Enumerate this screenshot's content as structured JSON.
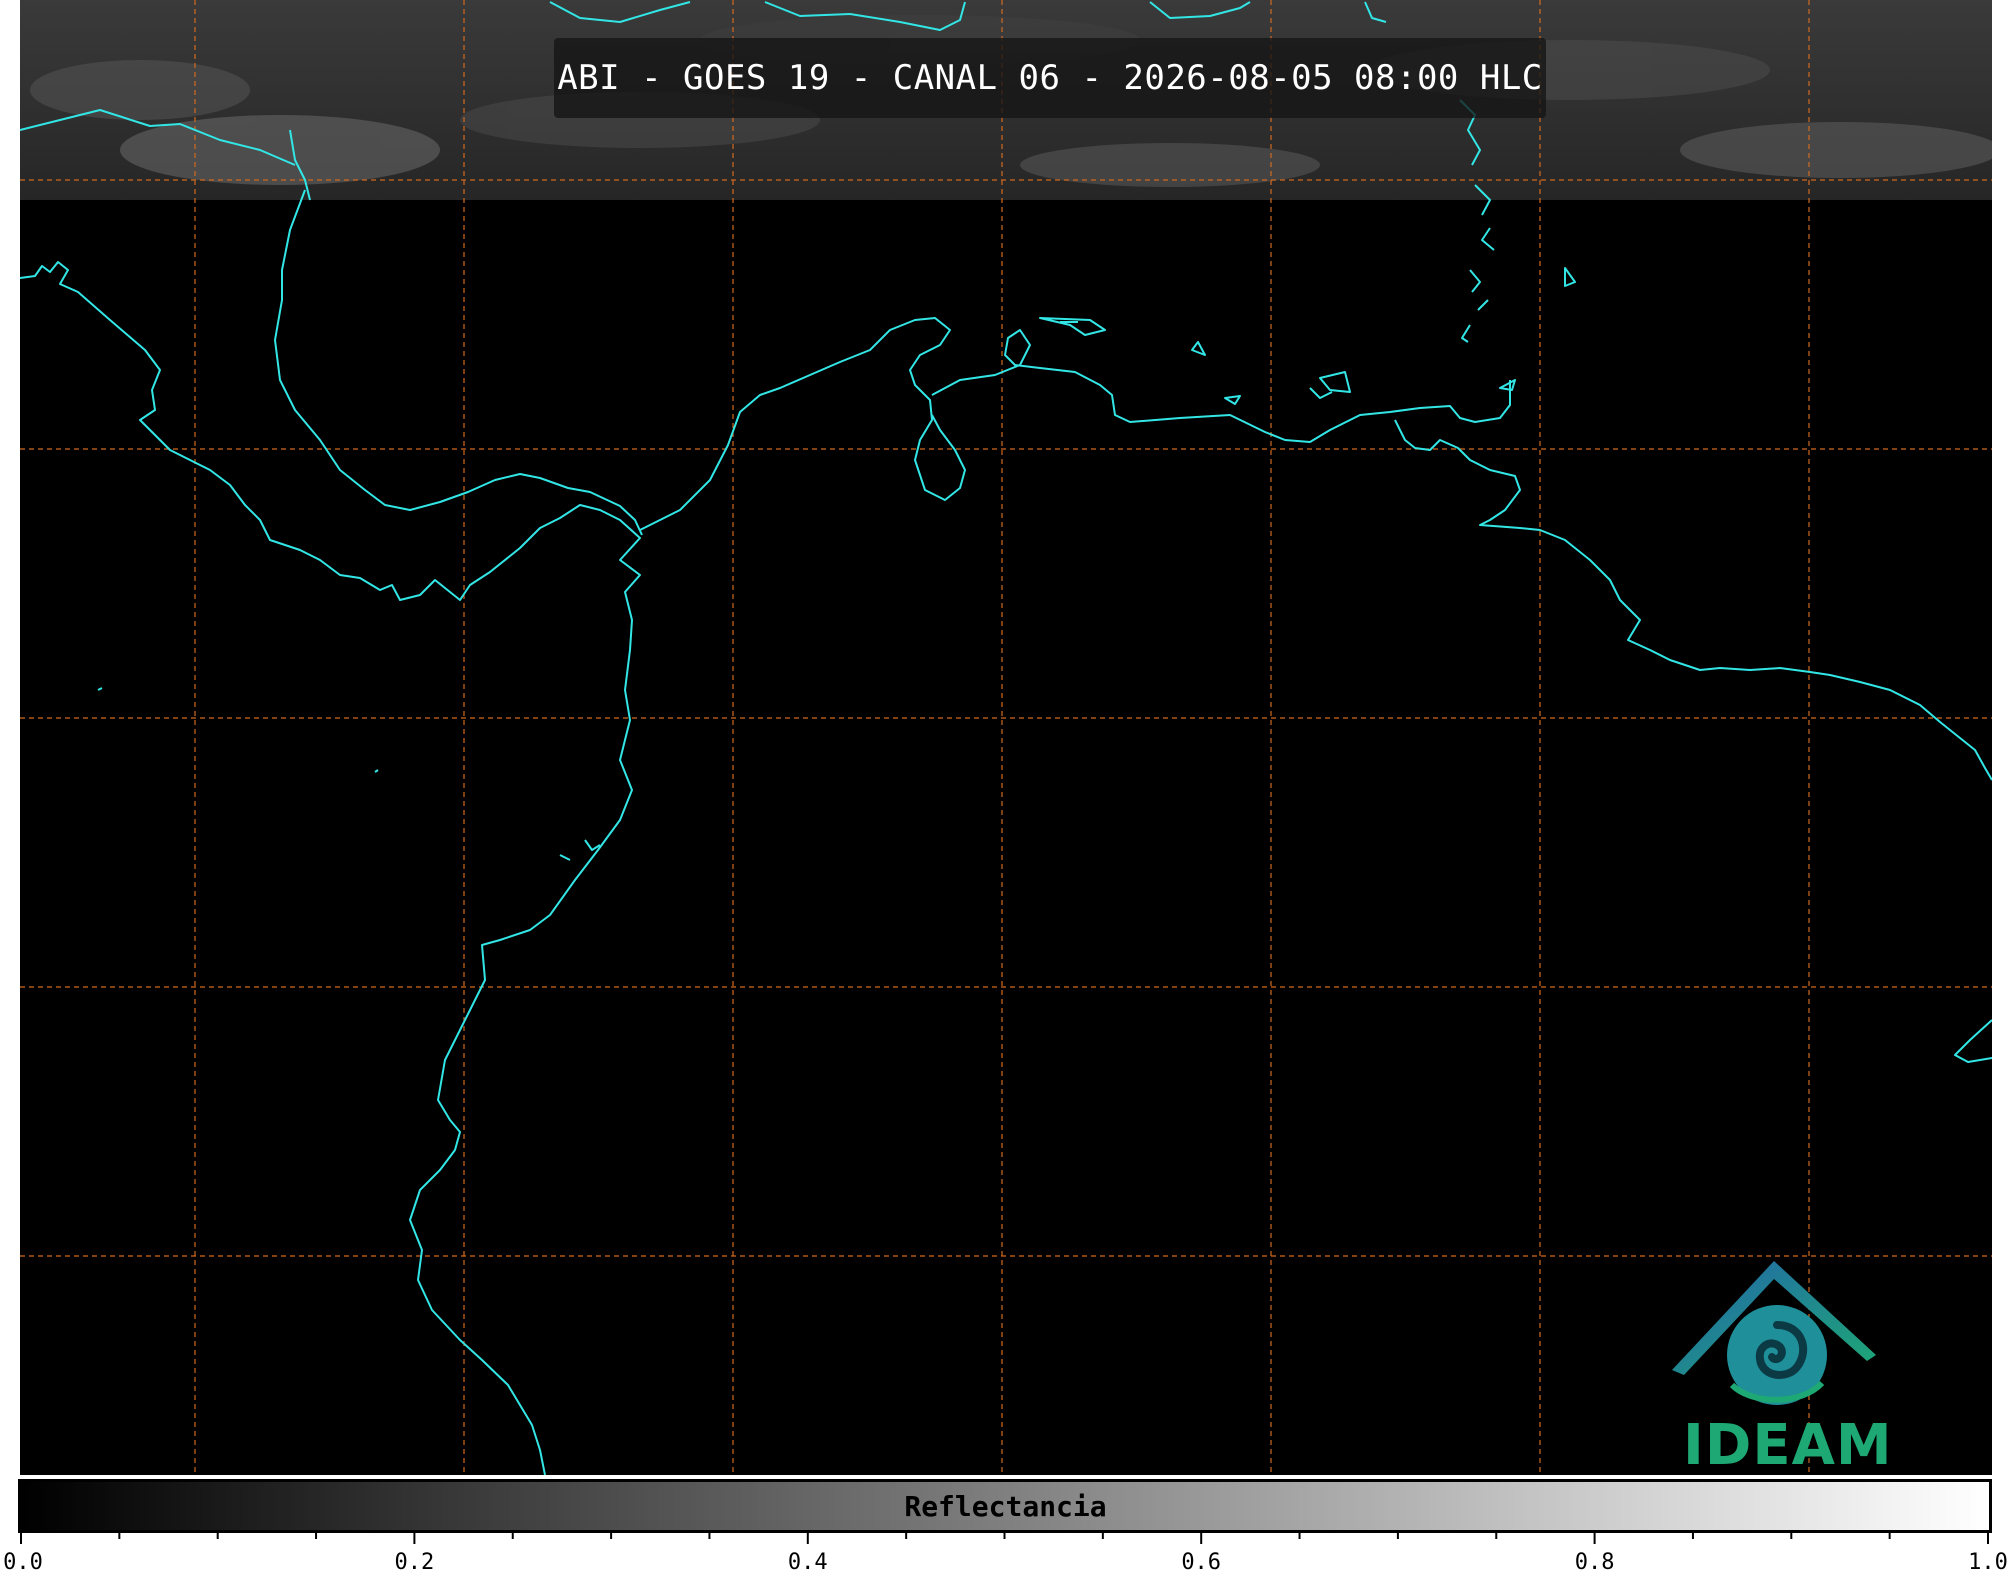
{
  "title": "ABI - GOES 19 - CANAL 06 - 2026-08-05 08:00 HLC",
  "map": {
    "coastline_color": "#33e6e6",
    "grid_color": "#d2691e",
    "background": "#000000",
    "cloud_band": "top strip with grey cloud imagery"
  },
  "logo": {
    "text": "IDEAM"
  },
  "colorbar": {
    "label": "Reflectancia",
    "min": 0.0,
    "max": 1.0,
    "tick_labels": [
      "0.0",
      "0.2",
      "0.4",
      "0.6",
      "0.8",
      "1.0"
    ],
    "gradient": [
      "#000000",
      "#ffffff"
    ]
  }
}
